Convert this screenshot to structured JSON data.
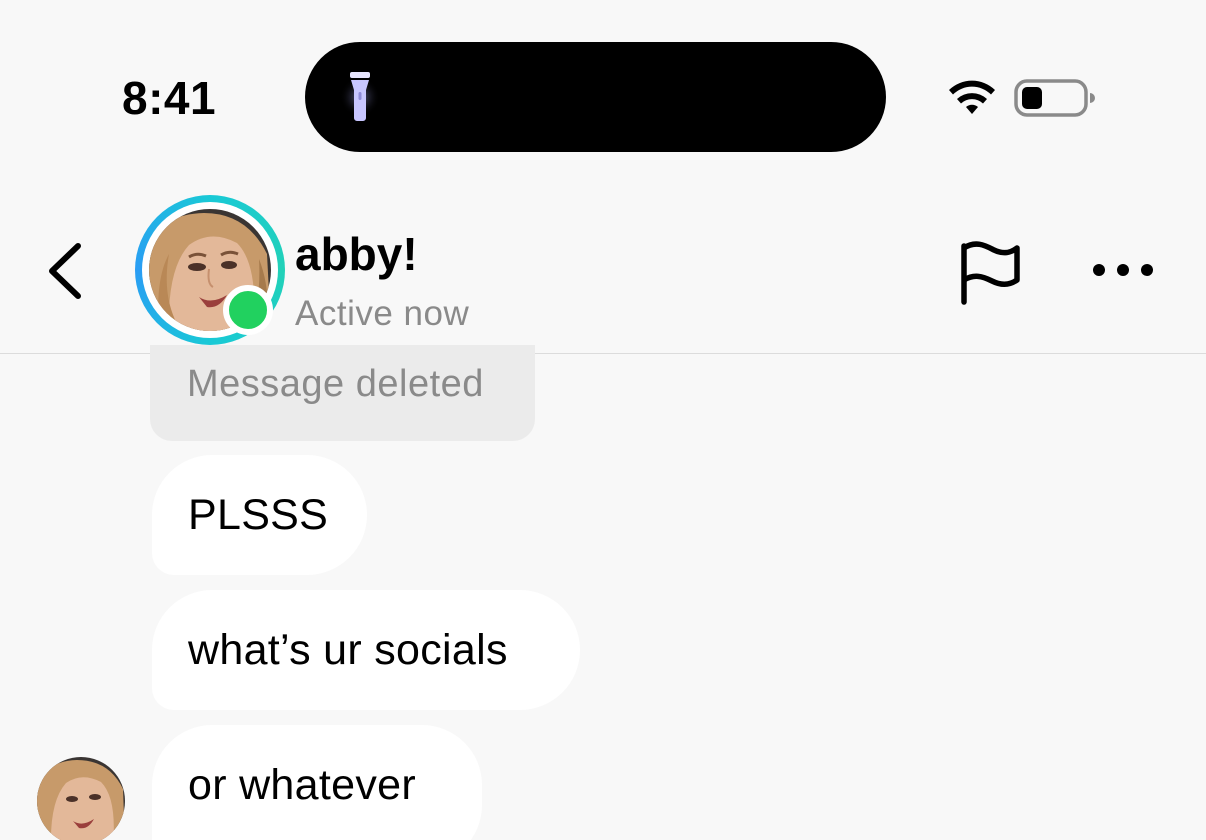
{
  "status_bar": {
    "time": "8:41",
    "island_icon": "flashlight-icon",
    "wifi_icon": "wifi-icon",
    "battery_icon": "battery-icon"
  },
  "header": {
    "back_icon": "chevron-left-icon",
    "name": "abby!",
    "status": "Active now",
    "flag_icon": "flag-icon",
    "more_icon": "more-horizontal-icon",
    "online_color": "#21d15f",
    "ring_colors": [
      "#19c9d6",
      "#2a9df4"
    ]
  },
  "messages": [
    {
      "text": "Message deleted",
      "deleted": true
    },
    {
      "text": "PLSSS"
    },
    {
      "text": "what’s ur socials"
    },
    {
      "text": "or whatever"
    }
  ]
}
